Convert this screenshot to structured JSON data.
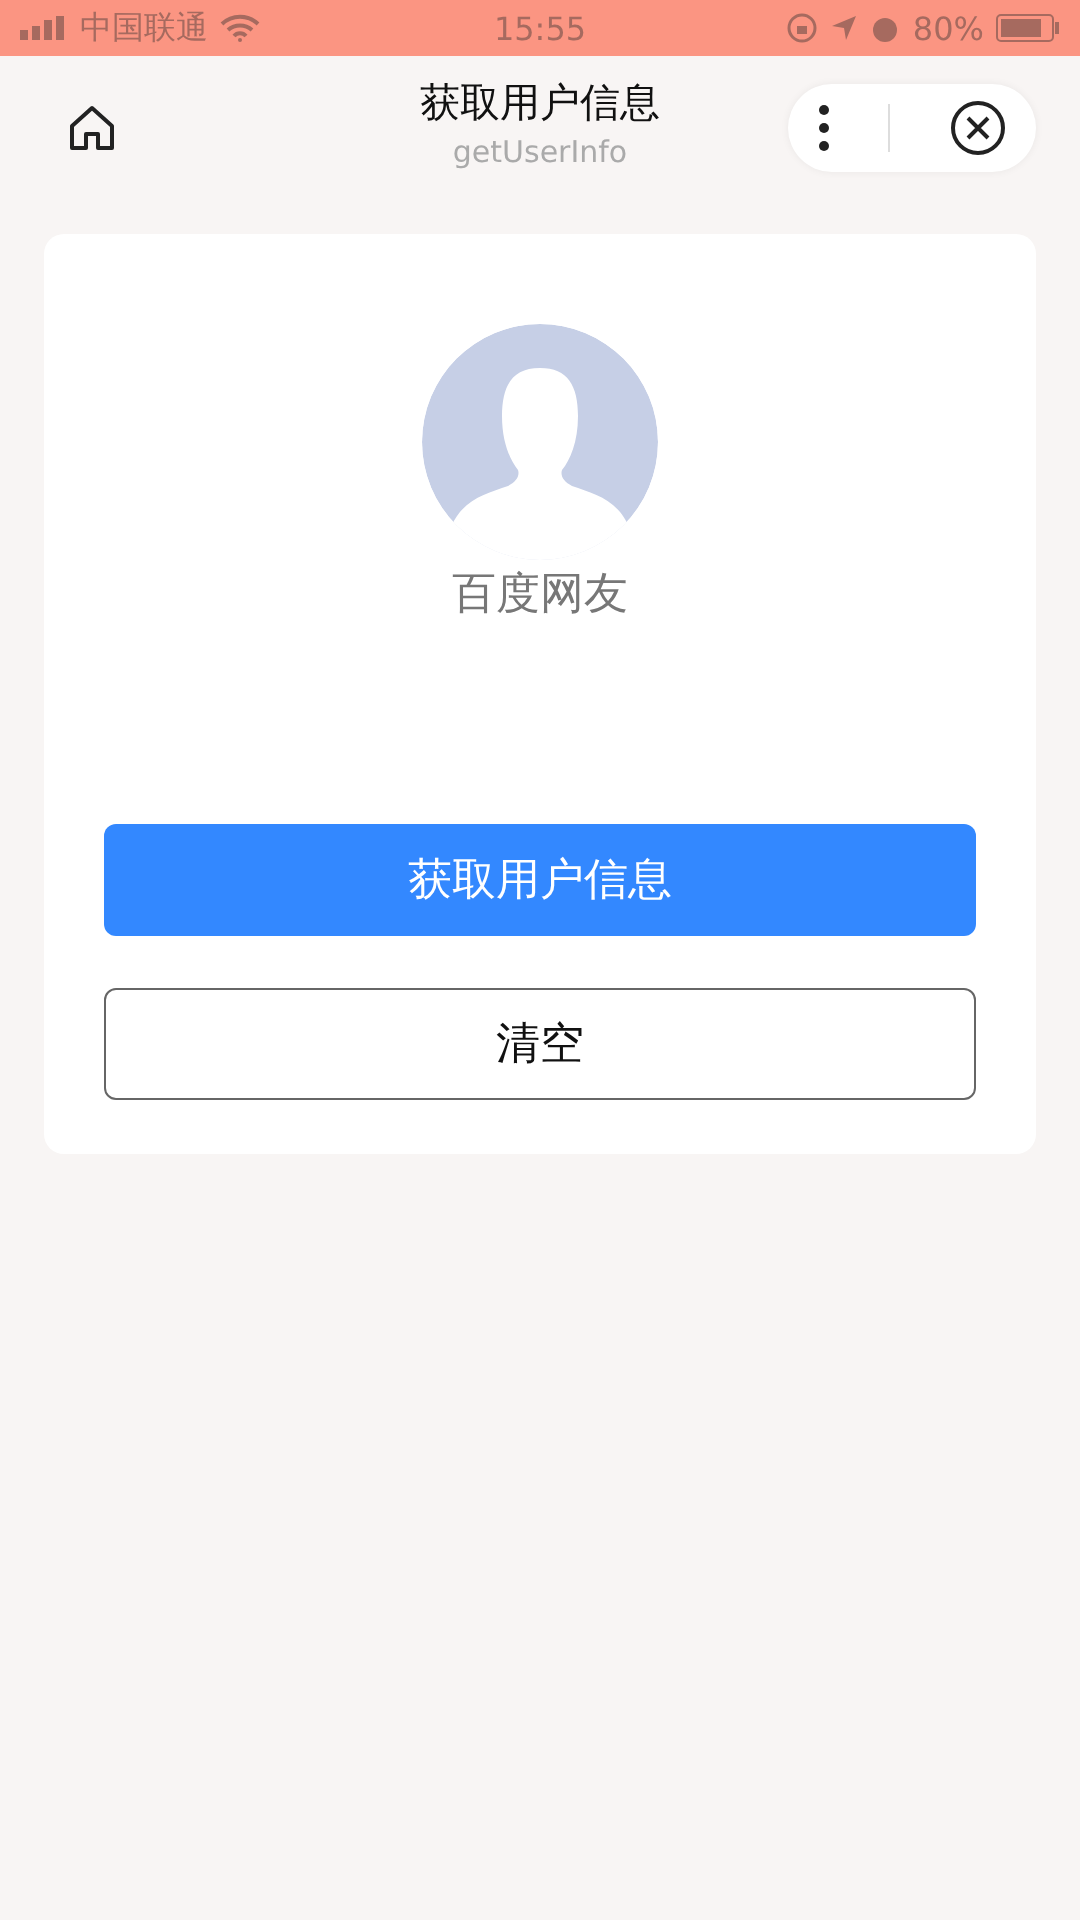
{
  "status_bar": {
    "carrier": "中国联通",
    "time": "15:55",
    "battery": "80%"
  },
  "nav": {
    "title": "获取用户信息",
    "subtitle": "getUserInfo"
  },
  "user": {
    "nickname": "百度网友"
  },
  "buttons": [
    {
      "label": "获取用户信息",
      "kind": "primary"
    },
    {
      "label": "清空",
      "kind": "secondary"
    }
  ]
}
